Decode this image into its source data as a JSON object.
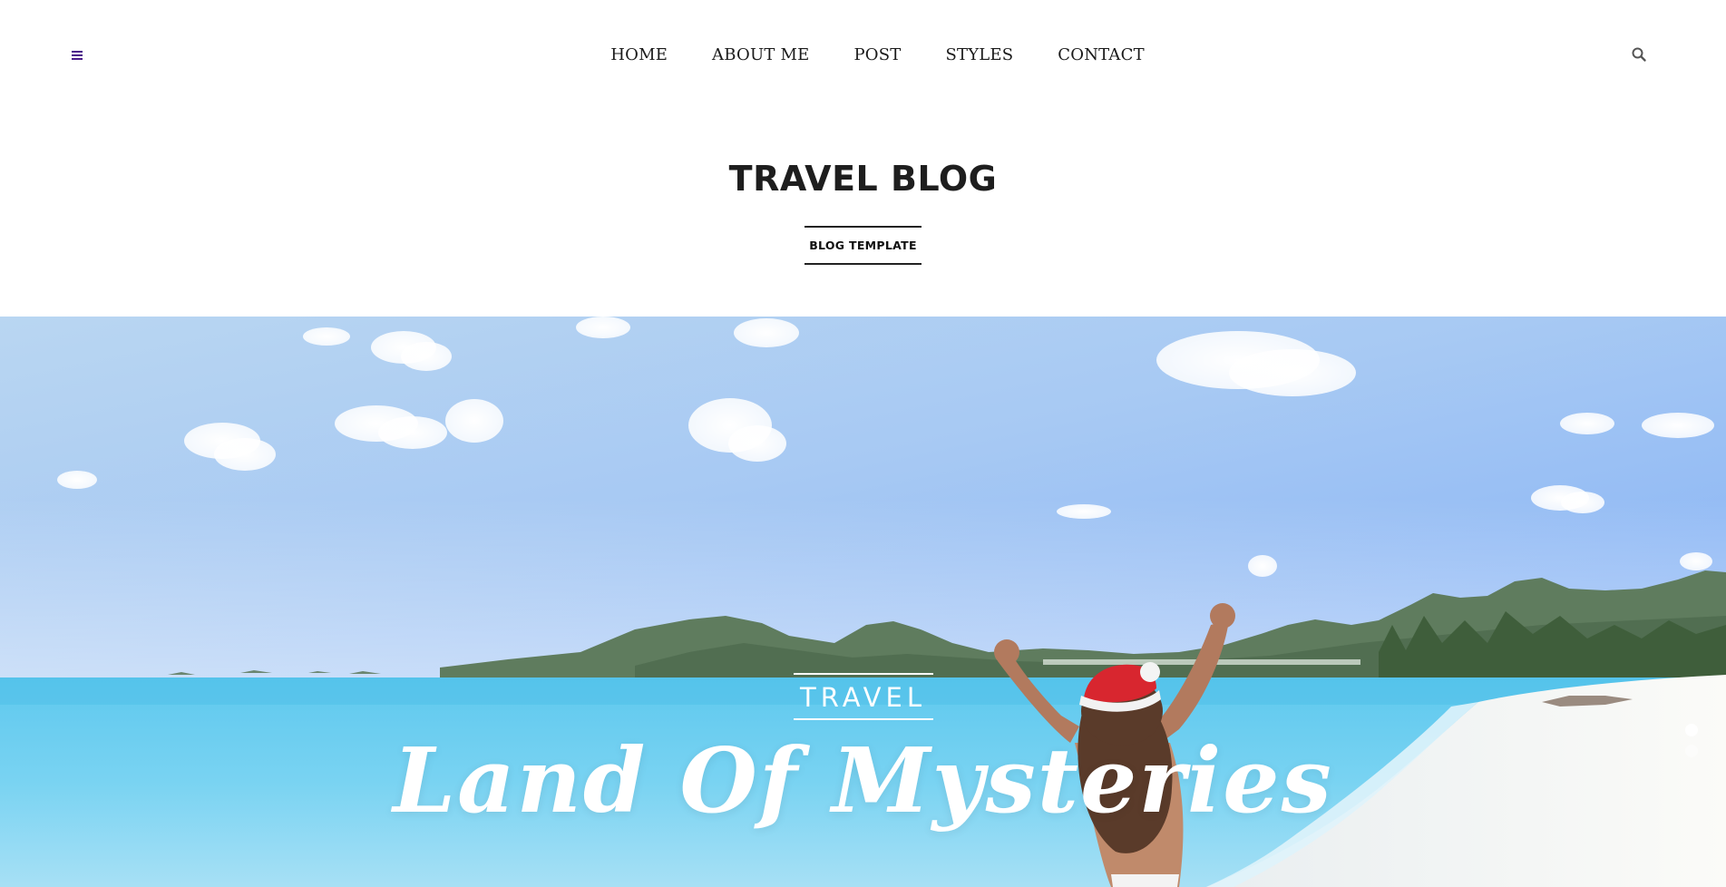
{
  "colors": {
    "accent": "#4b1c8a",
    "nav_text": "#1a1a1a",
    "title_text": "#1e1e1e",
    "hero_text": "#ffffff"
  },
  "header": {
    "menu_icon": "hamburger-menu-icon",
    "search_icon": "search-icon",
    "nav": [
      "HOME",
      "ABOUT ME",
      "POST",
      "STYLES",
      "CONTACT"
    ]
  },
  "site": {
    "title": "TRAVEL BLOG",
    "tagline": "BLOG TEMPLATE"
  },
  "hero": {
    "category": "TRAVEL",
    "headline": "Land Of Mysteries",
    "slides_total": 2,
    "active_slide": 1
  }
}
